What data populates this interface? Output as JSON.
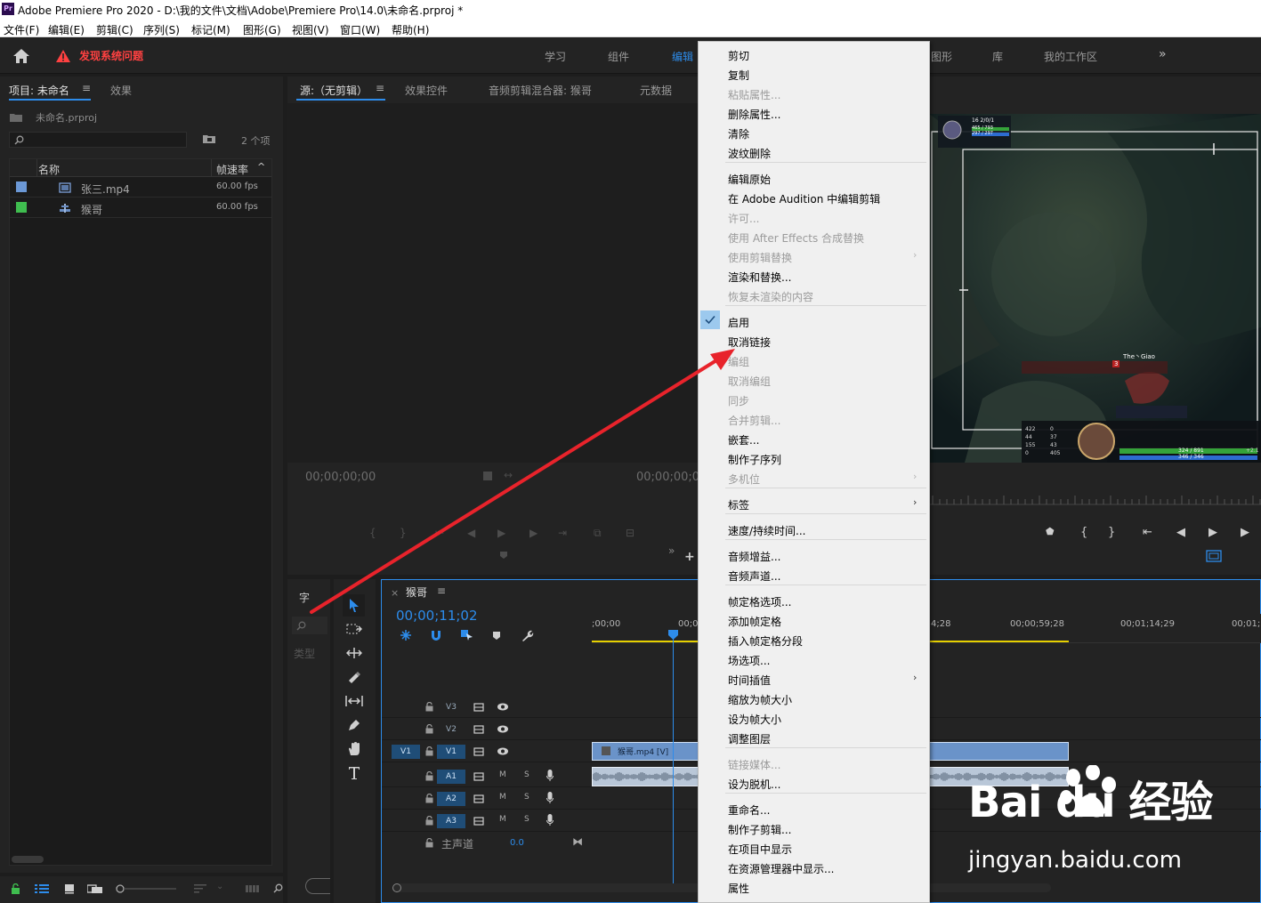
{
  "window": {
    "app_logo": "Pr",
    "title": "Adobe Premiere Pro 2020 - D:\\我的文件\\文档\\Adobe\\Premiere Pro\\14.0\\未命名.prproj *"
  },
  "menubar": [
    "文件(F)",
    "编辑(E)",
    "剪辑(C)",
    "序列(S)",
    "标记(M)",
    "图形(G)",
    "视图(V)",
    "窗口(W)",
    "帮助(H)"
  ],
  "header": {
    "warning_text": "发现系统问题",
    "workspaces": [
      "学习",
      "组件",
      "编辑",
      "图形",
      "库",
      "我的工作区"
    ],
    "overflow": "»"
  },
  "project_panel": {
    "tab_project": "项目: 未命名",
    "tab_effects": "效果",
    "file_name": "未命名.prproj",
    "item_count": "2 个项",
    "col_name": "名称",
    "col_fps": "帧速率",
    "items": [
      {
        "name": "张三.mp4",
        "fps": "60.00 fps",
        "color": "#6b98d6"
      },
      {
        "name": "猴哥",
        "fps": "60.00 fps",
        "color": "#3fbd4f"
      }
    ]
  },
  "source_panel": {
    "tab_source": "源:（无剪辑）",
    "tab_effect_controls": "效果控件",
    "tab_audio_mixer": "音频剪辑混合器: 猴哥",
    "tab_metadata": "元数据",
    "timecode_in": "00;00;00;00",
    "timecode_out": "00;00;00;0"
  },
  "tiny_panel": {
    "label_char": "字",
    "label_type": "类型"
  },
  "timeline": {
    "sequence_name": "猴哥",
    "timecode": "00;00;11;02",
    "ruler_labels": [
      ";00;00",
      "00;0",
      "4;28",
      "00;00;59;28",
      "00;01;14;29",
      "00;01;2"
    ],
    "tracks_video": [
      "V3",
      "V2",
      "V1"
    ],
    "tracks_audio": [
      "A1",
      "A2",
      "A3"
    ],
    "source_patch_v": "V1",
    "master_label": "主声道",
    "master_value": "0.0",
    "clip_name": "猴哥.mp4 [V]",
    "mute_label": "M",
    "solo_label": "S"
  },
  "game_hud": {
    "player_name": "The丶Giao",
    "level_badge": "3",
    "hp_text": "324 / 891",
    "mp_text": "346 / 346",
    "regen": "+2.1",
    "stats_top": "16  2/0/1",
    "hp_top": "465 / 793",
    "mp_top": "297 / 297",
    "stats_left": [
      "422",
      "44",
      "155",
      "0"
    ],
    "stats_left2": [
      "0",
      "37",
      "43",
      "405"
    ]
  },
  "context_menu": {
    "items": [
      {
        "label": "剪切",
        "disabled": false
      },
      {
        "label": "复制",
        "disabled": false
      },
      {
        "label": "粘贴属性...",
        "disabled": true
      },
      {
        "label": "删除属性...",
        "disabled": false
      },
      {
        "label": "清除",
        "disabled": false
      },
      {
        "label": "波纹删除",
        "disabled": false
      },
      {
        "label": "编辑原始",
        "disabled": false
      },
      {
        "label": "在 Adobe Audition 中编辑剪辑",
        "disabled": false
      },
      {
        "label": "许可...",
        "disabled": true
      },
      {
        "label": "使用 After Effects 合成替换",
        "disabled": true
      },
      {
        "label": "使用剪辑替换",
        "disabled": true
      },
      {
        "label": "渲染和替换...",
        "disabled": false
      },
      {
        "label": "恢复未渲染的内容",
        "disabled": true
      },
      {
        "label": "启用",
        "disabled": false,
        "checked": true
      },
      {
        "label": "取消链接",
        "disabled": false
      },
      {
        "label": "编组",
        "disabled": true
      },
      {
        "label": "取消编组",
        "disabled": true
      },
      {
        "label": "同步",
        "disabled": true
      },
      {
        "label": "合并剪辑...",
        "disabled": true
      },
      {
        "label": "嵌套...",
        "disabled": false
      },
      {
        "label": "制作子序列",
        "disabled": false
      },
      {
        "label": "多机位",
        "disabled": true
      },
      {
        "label": "标签",
        "disabled": false
      },
      {
        "label": "速度/持续时间...",
        "disabled": false
      },
      {
        "label": "音频增益...",
        "disabled": false
      },
      {
        "label": "音频声道...",
        "disabled": false
      },
      {
        "label": "帧定格选项...",
        "disabled": false
      },
      {
        "label": "添加帧定格",
        "disabled": false
      },
      {
        "label": "插入帧定格分段",
        "disabled": false
      },
      {
        "label": "场选项...",
        "disabled": false
      },
      {
        "label": "时间插值",
        "disabled": false
      },
      {
        "label": "缩放为帧大小",
        "disabled": false
      },
      {
        "label": "设为帧大小",
        "disabled": false
      },
      {
        "label": "调整图层",
        "disabled": false
      },
      {
        "label": "链接媒体...",
        "disabled": true
      },
      {
        "label": "设为脱机...",
        "disabled": false
      },
      {
        "label": "重命名...",
        "disabled": false
      },
      {
        "label": "制作子剪辑...",
        "disabled": false
      },
      {
        "label": "在项目中显示",
        "disabled": false
      },
      {
        "label": "在资源管理器中显示...",
        "disabled": false
      },
      {
        "label": "属性",
        "disabled": false
      }
    ],
    "submenu_arrow": "›"
  },
  "watermark": {
    "logo": "Bai du 经验",
    "url": "jingyan.baidu.com"
  },
  "colors": {
    "accent": "#2d8ceb",
    "warning": "#ff4141",
    "annotation_arrow": "#e8232b"
  }
}
